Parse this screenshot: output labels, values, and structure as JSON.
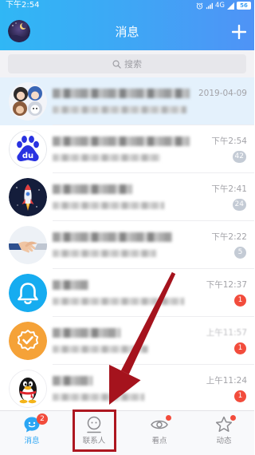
{
  "status_bar": {
    "time": "下午2:54",
    "network": "4G",
    "battery": "56",
    "icons": [
      "alarm-icon",
      "signal-bars-icon",
      "signal-triangle-icon",
      "battery-icon"
    ]
  },
  "header": {
    "title": "消息",
    "left_icon": "user-avatar",
    "right_icon": "plus-icon"
  },
  "search": {
    "placeholder": "搜索",
    "icon": "search-icon"
  },
  "conversations": [
    {
      "avatar": "group-avatar",
      "time": "2019-04-09",
      "pinned": true
    },
    {
      "avatar": "baidu-logo-avatar",
      "logo_text": "du",
      "time": "下午2:54",
      "badge": "42",
      "badge_color": "#c4cbd5"
    },
    {
      "avatar": "rocket-avatar",
      "time": "下午2:41",
      "badge": "24",
      "badge_color": "#c4cbd5"
    },
    {
      "avatar": "handshake-avatar",
      "time": "下午2:22",
      "badge": "5",
      "badge_color": "#c4cbd5"
    },
    {
      "avatar": "bell-avatar",
      "time": "下午12:37",
      "badge": "1",
      "badge_color": "#f24c3c"
    },
    {
      "avatar": "verified-badge-avatar",
      "time": "上午11:57",
      "badge": "1",
      "badge_color": "#f24c3c"
    },
    {
      "avatar": "qq-penguin-avatar",
      "time": "上午11:24",
      "badge": "1",
      "badge_color": "#f24c3c"
    }
  ],
  "tabs": [
    {
      "label": "消息",
      "icon": "chat-bubble-icon",
      "badge": "2",
      "active": true
    },
    {
      "label": "联系人",
      "icon": "contacts-icon",
      "annotated": true
    },
    {
      "label": "看点",
      "icon": "eye-icon",
      "dot": true
    },
    {
      "label": "动态",
      "icon": "star-icon",
      "dot": true
    }
  ],
  "colors": {
    "header_start": "#30b7f5",
    "header_end": "#4f93f6",
    "accent": "#2ba6f4",
    "badge_red": "#f24c3c",
    "badge_gray": "#c4cbd5",
    "pinned_row": "#e4f1fc",
    "annotation_red": "#ad1720"
  }
}
